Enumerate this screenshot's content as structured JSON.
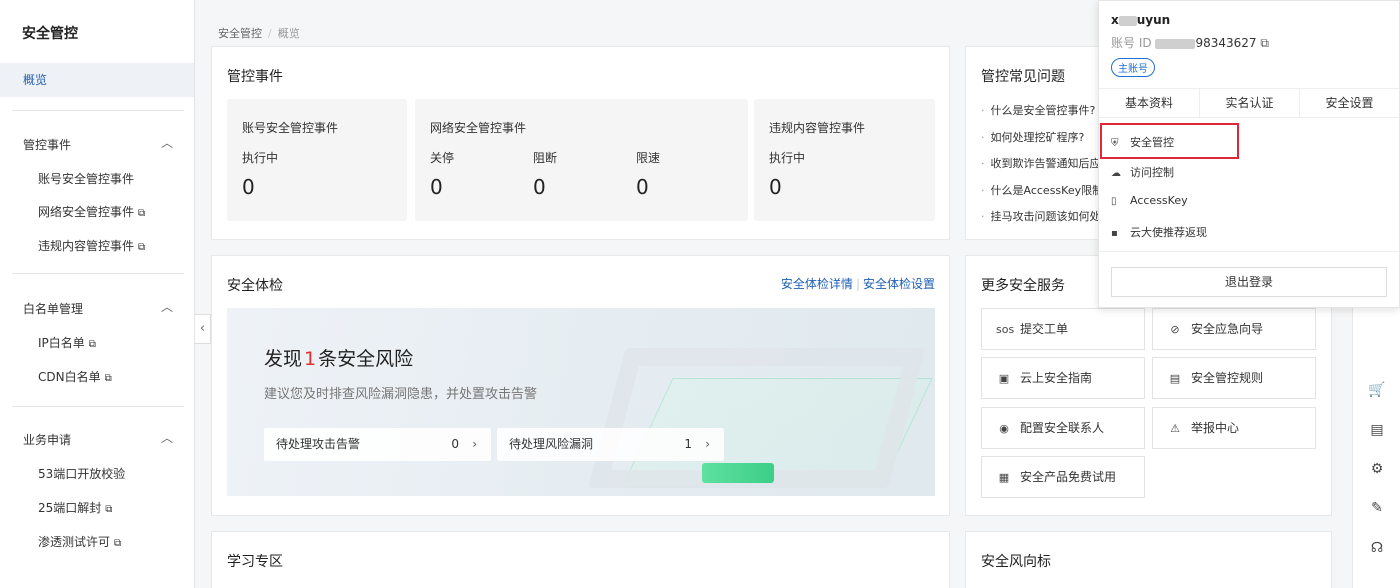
{
  "sidebar": {
    "title": "安全管控",
    "active": "概览",
    "groups": [
      {
        "title": "管控事件",
        "items": [
          "账号安全管控事件",
          "网络安全管控事件",
          "违规内容管控事件"
        ]
      },
      {
        "title": "白名单管理",
        "items": [
          "IP白名单",
          "CDN白名单"
        ]
      },
      {
        "title": "业务申请",
        "items": [
          "53端口开放校验",
          "25端口解封",
          "渗透测试许可"
        ]
      }
    ]
  },
  "breadcrumb": [
    "安全管控",
    "概览"
  ],
  "events": {
    "title": "管控事件",
    "account": {
      "title": "账号安全管控事件",
      "label": "执行中",
      "value": "0"
    },
    "network": {
      "title": "网络安全管控事件",
      "labels": [
        "关停",
        "阻断",
        "限速"
      ],
      "values": [
        "0",
        "0",
        "0"
      ]
    },
    "content": {
      "title": "违规内容管控事件",
      "label": "执行中",
      "value": "0"
    }
  },
  "faq": {
    "title": "管控常见问题",
    "items": [
      "什么是安全管控事件?",
      "如何处理挖矿程序?",
      "收到欺诈告警通知后应",
      "什么是AccessKey限制",
      "挂马攻击问题该如何处"
    ]
  },
  "checkup": {
    "title": "安全体检",
    "link1": "安全体检详情",
    "link2": "安全体检设置",
    "headline_pre": "发现",
    "headline_num": "1",
    "headline_post": "条安全风险",
    "subtitle": "建议您及时排查风险漏洞隐患，并处置攻击告警",
    "pill1": {
      "label": "待处理攻击告警",
      "value": "0"
    },
    "pill2": {
      "label": "待处理风险漏洞",
      "value": "1"
    }
  },
  "services": {
    "title": "更多安全服务",
    "items": [
      {
        "icon": "sos-icon",
        "glyph": "sos",
        "label": "提交工单"
      },
      {
        "icon": "emergency-icon",
        "glyph": "⊘",
        "label": "安全应急向导"
      },
      {
        "icon": "guide-icon",
        "glyph": "▣",
        "label": "云上安全指南"
      },
      {
        "icon": "rules-icon",
        "glyph": "▤",
        "label": "安全管控规则"
      },
      {
        "icon": "contact-icon",
        "glyph": "◉",
        "label": "配置安全联系人"
      },
      {
        "icon": "report-icon",
        "glyph": "⚠",
        "label": "举报中心"
      },
      {
        "icon": "trial-icon",
        "glyph": "▦",
        "label": "安全产品免费试用"
      }
    ]
  },
  "learning": {
    "title": "学习专区"
  },
  "trends": {
    "title": "安全风向标"
  },
  "dropdown": {
    "username_suffix": "uyun",
    "username_prefix": "x",
    "id_label": "账号 ID",
    "id_suffix": "98343627",
    "badge": "主账号",
    "tabs": [
      "基本资料",
      "实名认证",
      "安全设置"
    ],
    "menu": [
      {
        "icon": "shield-icon",
        "glyph": "⛨",
        "label": "安全管控"
      },
      {
        "icon": "cloud-icon",
        "glyph": "☁",
        "label": "访问控制"
      },
      {
        "icon": "key-icon",
        "glyph": "▯",
        "label": "AccessKey"
      },
      {
        "icon": "gift-icon",
        "glyph": "▪",
        "label": "云大使推荐返现"
      }
    ],
    "logout": "退出登录"
  },
  "colors": {
    "accent": "#1f5fb8",
    "risk": "#e0302e",
    "highlight": "#e0283a"
  }
}
